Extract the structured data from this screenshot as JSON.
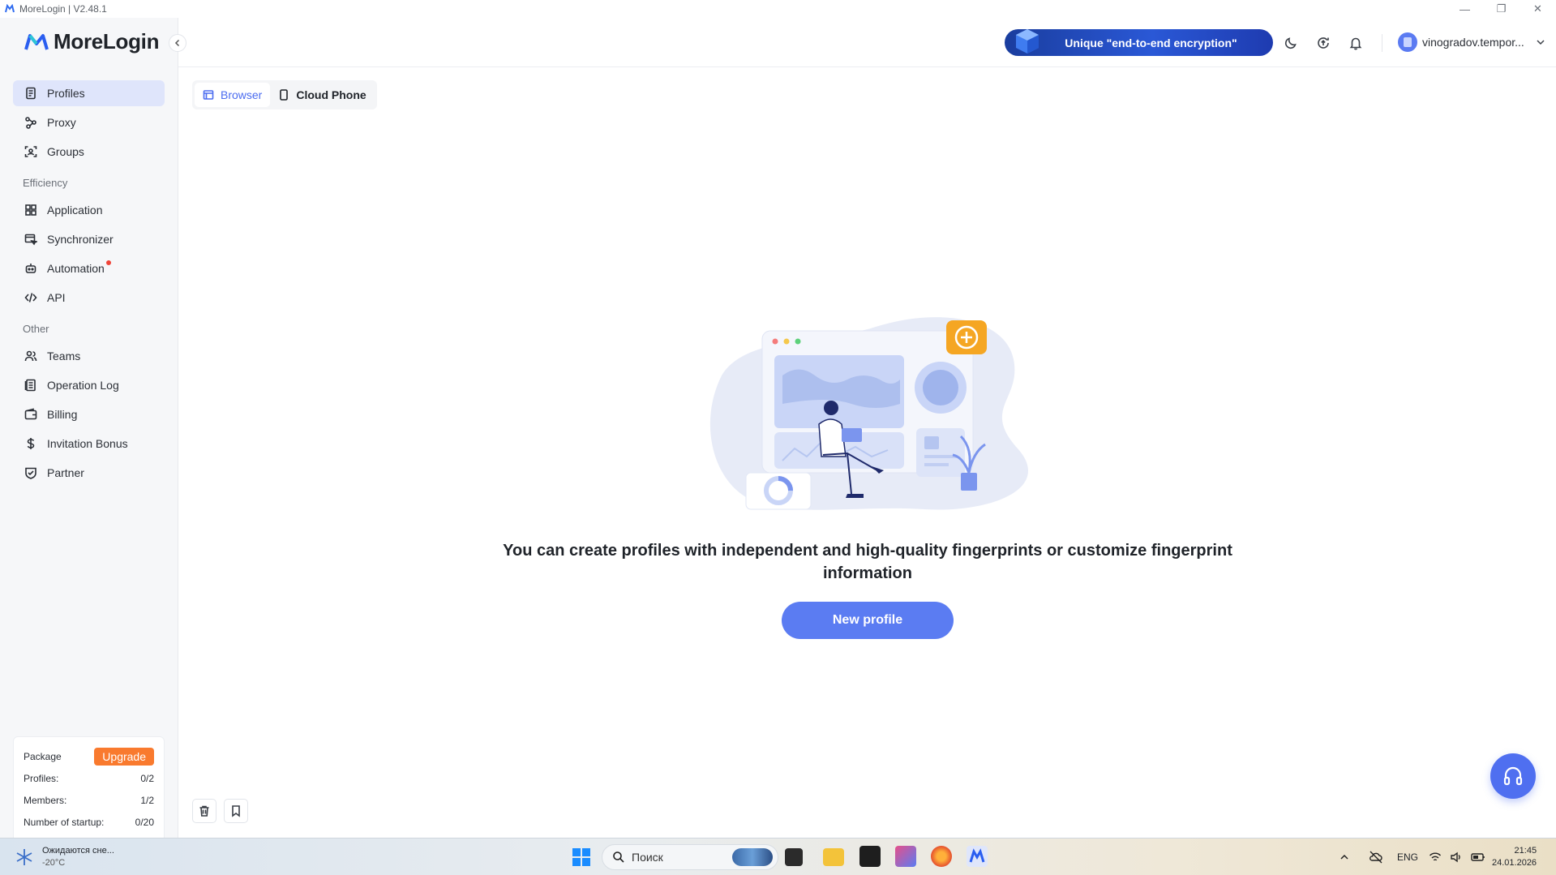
{
  "window": {
    "title": "MoreLogin | V2.48.1"
  },
  "brand": {
    "name": "MoreLogin",
    "accent": "#4f6ff0"
  },
  "sidebar": {
    "main_items": [
      {
        "label": "Profiles",
        "icon": "profiles-icon",
        "active": true
      },
      {
        "label": "Proxy",
        "icon": "proxy-icon"
      },
      {
        "label": "Groups",
        "icon": "groups-icon"
      }
    ],
    "efficiency_title": "Efficiency",
    "efficiency_items": [
      {
        "label": "Application",
        "icon": "grid-icon"
      },
      {
        "label": "Synchronizer",
        "icon": "synchronizer-icon"
      },
      {
        "label": "Automation",
        "icon": "robot-icon",
        "badge": "red-dot"
      },
      {
        "label": "API",
        "icon": "code-icon"
      }
    ],
    "other_title": "Other",
    "other_items": [
      {
        "label": "Teams",
        "icon": "users-icon"
      },
      {
        "label": "Operation Log",
        "icon": "log-icon"
      },
      {
        "label": "Billing",
        "icon": "wallet-icon"
      },
      {
        "label": "Invitation Bonus",
        "icon": "dollar-icon"
      },
      {
        "label": "Partner",
        "icon": "handshake-icon"
      }
    ],
    "package": {
      "label": "Package",
      "upgrade_label": "Upgrade",
      "rows": [
        {
          "label": "Profiles:",
          "value": "0/2"
        },
        {
          "label": "Members:",
          "value": "1/2"
        },
        {
          "label": "Number of startup:",
          "value": "0/20"
        }
      ]
    }
  },
  "header": {
    "promo_text": "Unique \"end-to-end encryption\"",
    "user_name": "vinogradov.tempor..."
  },
  "tabs": [
    {
      "label": "Browser",
      "active": true
    },
    {
      "label": "Cloud Phone",
      "active": false
    }
  ],
  "empty_state": {
    "message": "You can create profiles with independent and high-quality fingerprints or customize fingerprint information",
    "button_label": "New profile"
  },
  "taskbar": {
    "weather_title": "Ожидаются сне...",
    "weather_temp": "-20°C",
    "search_placeholder": "Поиск",
    "language": "ENG",
    "time": "21:45",
    "date": "24.01.2026"
  }
}
